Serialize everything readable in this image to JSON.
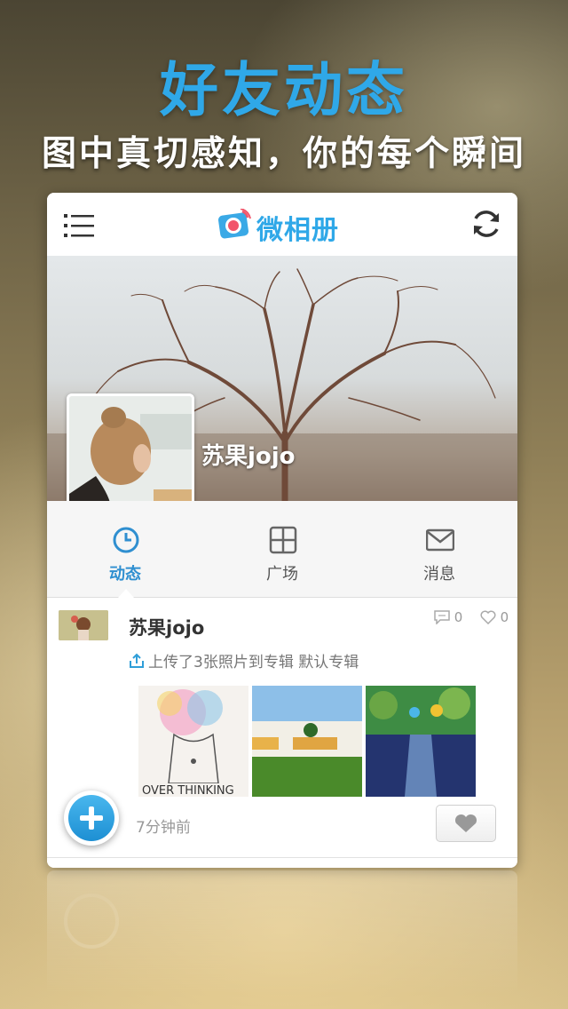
{
  "promo": {
    "title": "好友动态",
    "subtitle": "图中真切感知，你的每个瞬间"
  },
  "app": {
    "logo_text": "微相册",
    "icons": {
      "menu": "menu-icon",
      "refresh": "refresh-icon",
      "logo": "camera-logo-icon"
    },
    "accent_color": "#2fa8e8"
  },
  "profile": {
    "name": "苏果jojo"
  },
  "tabs": [
    {
      "label": "动态",
      "icon": "clock-icon",
      "active": true
    },
    {
      "label": "广场",
      "icon": "grid-icon",
      "active": false
    },
    {
      "label": "消息",
      "icon": "mail-icon",
      "active": false
    }
  ],
  "feed": {
    "posts": [
      {
        "user": "苏果jojo",
        "comments": "0",
        "likes": "0",
        "action": "上传了3张照片到专辑 默认专辑",
        "photo_count": 3,
        "time": "7分钟前"
      }
    ]
  }
}
